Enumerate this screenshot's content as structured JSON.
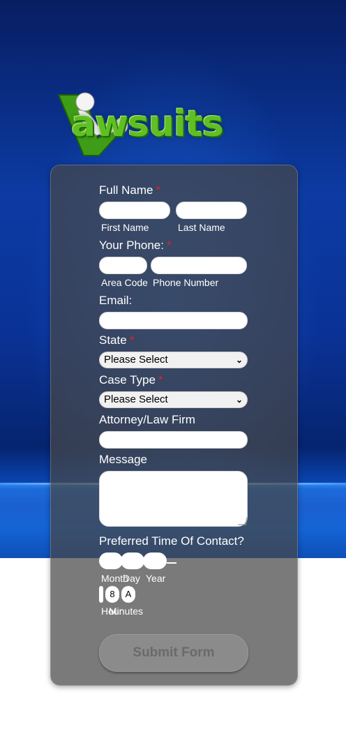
{
  "brand": {
    "logo_text": "awsuits"
  },
  "form": {
    "full_name": {
      "label": "Full Name",
      "required_mark": "*",
      "first_caption": "First Name",
      "last_caption": "Last Name"
    },
    "phone": {
      "label": "Your Phone:",
      "required_mark": "*",
      "area_caption": "Area Code",
      "number_caption": "Phone Number"
    },
    "email": {
      "label": "Email:"
    },
    "state": {
      "label": "State",
      "required_mark": "*",
      "selected": "Please Select"
    },
    "case_type": {
      "label": "Case Type",
      "required_mark": "*",
      "selected": "Please Select"
    },
    "attorney": {
      "label": "Attorney/Law Firm"
    },
    "message": {
      "label": "Message"
    },
    "contact_time": {
      "label": "Preferred Time Of Contact?",
      "month_caption": "Month",
      "day_caption": "Day",
      "year_caption": "Year",
      "hour_value": "8",
      "ampm_value": "A",
      "hour_caption": "Hour",
      "minutes_caption": "Minutes"
    },
    "submit_label": "Submit Form"
  },
  "colors": {
    "required": "#e02424",
    "logo_green": "#5fbf23",
    "card_bg": "#464646"
  }
}
